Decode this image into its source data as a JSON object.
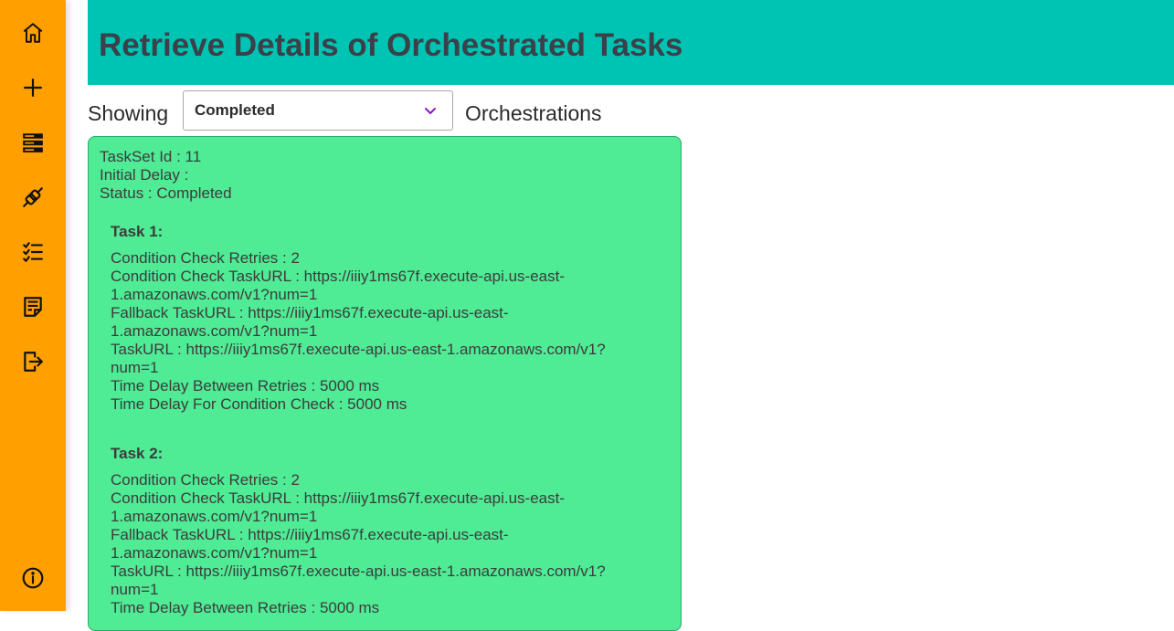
{
  "header": {
    "title": "Retrieve Details of Orchestrated Tasks"
  },
  "filter": {
    "showing_label": "Showing",
    "selected_status": "Completed",
    "suffix_label": "Orchestrations"
  },
  "sidebar": {
    "items": [
      {
        "icon": "home-icon"
      },
      {
        "icon": "plus-icon"
      },
      {
        "icon": "server-icon"
      },
      {
        "icon": "plug-icon"
      },
      {
        "icon": "checklist-icon"
      },
      {
        "icon": "document-icon"
      },
      {
        "icon": "logout-icon"
      },
      {
        "icon": "info-icon"
      }
    ]
  },
  "taskset": {
    "id_line": "TaskSet Id : 11",
    "delay_line": "Initial Delay :",
    "status_line": "Status : Completed",
    "tasks": [
      {
        "title": "Task 1:",
        "lines": [
          "Condition Check Retries : 2",
          "Condition Check TaskURL : https://iiiy1ms67f.execute-api.us-east-1.amazonaws.com/v1?num=1",
          "Fallback TaskURL : https://iiiy1ms67f.execute-api.us-east-1.amazonaws.com/v1?num=1",
          "TaskURL : https://iiiy1ms67f.execute-api.us-east-1.amazonaws.com/v1?num=1",
          "Time Delay Between Retries : 5000 ms",
          "Time Delay For Condition Check : 5000 ms"
        ]
      },
      {
        "title": "Task 2:",
        "lines": [
          "Condition Check Retries : 2",
          "Condition Check TaskURL : https://iiiy1ms67f.execute-api.us-east-1.amazonaws.com/v1?num=1",
          "Fallback TaskURL : https://iiiy1ms67f.execute-api.us-east-1.amazonaws.com/v1?num=1",
          "TaskURL : https://iiiy1ms67f.execute-api.us-east-1.amazonaws.com/v1?num=1",
          "Time Delay Between Retries : 5000 ms"
        ]
      }
    ]
  },
  "colors": {
    "sidebar": "#FF9F00",
    "header": "#00C4B3",
    "card": "#4FEB95",
    "chevron": "#8a16c8"
  }
}
